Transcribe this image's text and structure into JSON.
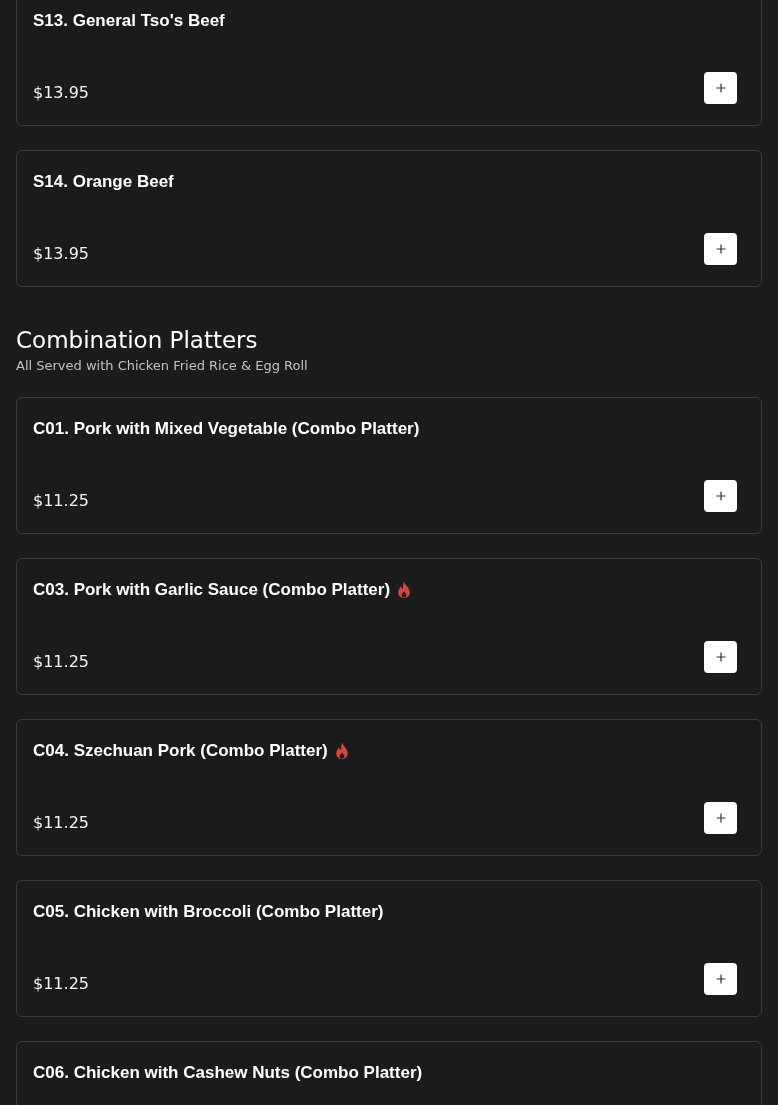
{
  "sections": [
    {
      "items": [
        {
          "name": "S13. General Tso's Beef",
          "price": "$13.95",
          "spicy": false
        },
        {
          "name": "S14. Orange Beef",
          "price": "$13.95",
          "spicy": false
        }
      ]
    },
    {
      "title": "Combination Platters",
      "subtitle": "All Served with Chicken Fried Rice & Egg Roll",
      "items": [
        {
          "name": "C01. Pork with Mixed Vegetable (Combo Platter)",
          "price": "$11.25",
          "spicy": false
        },
        {
          "name": "C03. Pork with Garlic Sauce (Combo Platter)",
          "price": "$11.25",
          "spicy": true
        },
        {
          "name": "C04. Szechuan Pork (Combo Platter)",
          "price": "$11.25",
          "spicy": true
        },
        {
          "name": "C05. Chicken with Broccoli (Combo Platter)",
          "price": "$11.25",
          "spicy": false
        },
        {
          "name": "C06. Chicken with Cashew Nuts (Combo Platter)",
          "spicy": false
        }
      ]
    }
  ]
}
